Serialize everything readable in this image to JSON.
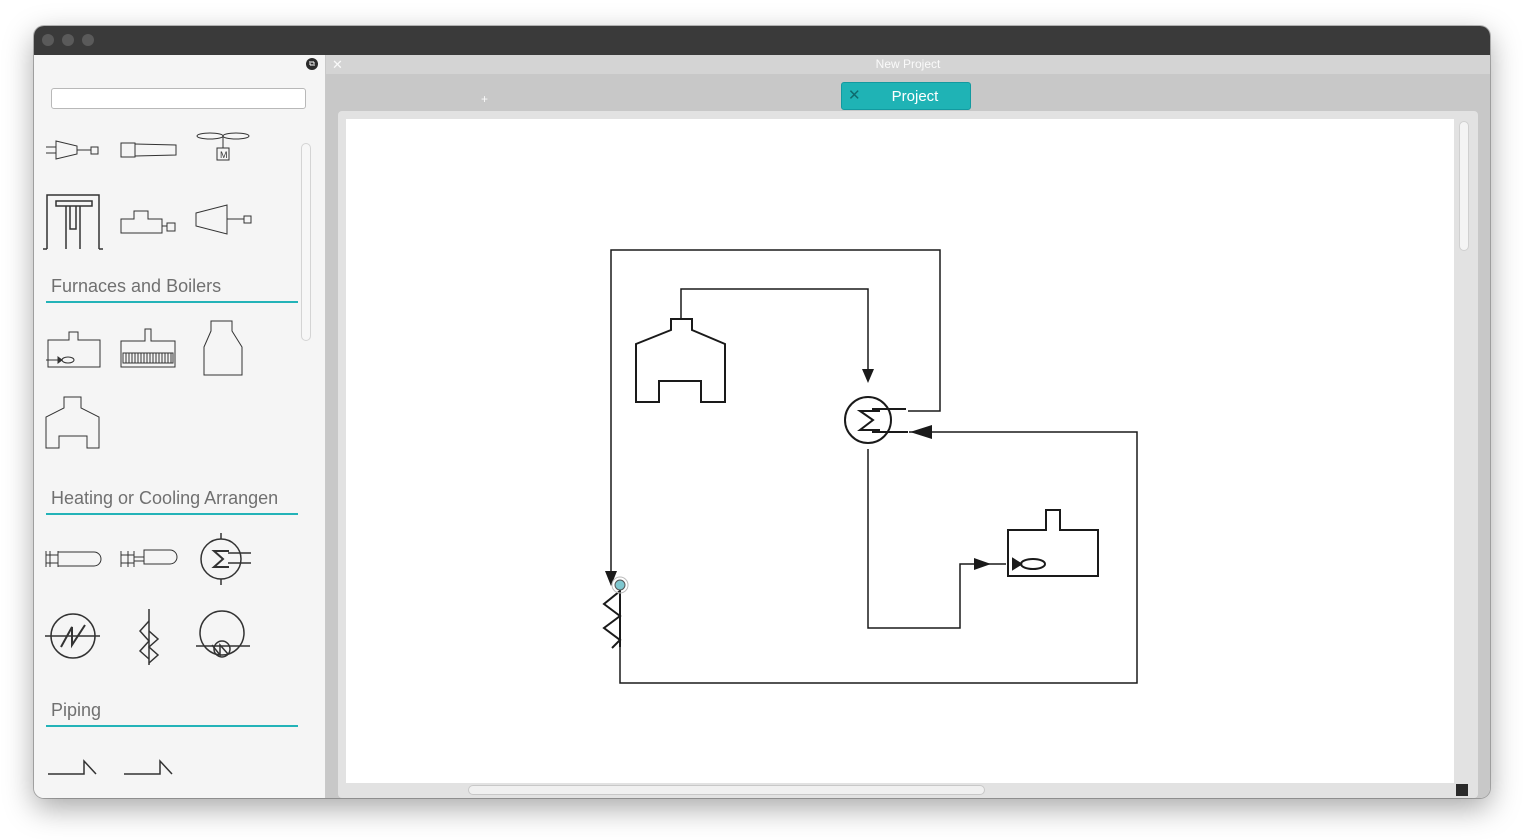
{
  "window": {
    "title": "New Project"
  },
  "sidebar": {
    "search": {
      "value": "",
      "placeholder": ""
    },
    "sections": [
      {
        "title": "Furnaces and Boilers"
      },
      {
        "title": "Heating or Cooling Arrangen"
      },
      {
        "title": "Piping"
      }
    ],
    "icons": {
      "undock": "undock-icon",
      "compressors": [
        "compressor-motor-icon",
        "blower-icon",
        "fan-motor-icon",
        "press-icon",
        "pump-motor-icon",
        "turbine-icon"
      ],
      "furnaces": [
        "furnace-burner-icon",
        "boiler-tubes-icon",
        "bottle-furnace-icon",
        "furnace-icon"
      ],
      "heating": [
        "heater-rod-icon",
        "heater-tube-icon",
        "heat-exchanger-icon",
        "cooler-icon",
        "coil-heater-icon",
        "circular-heater-icon"
      ],
      "piping": [
        "pipe-reducer-icon",
        "pipe-reducer-2-icon"
      ]
    }
  },
  "tabs": {
    "add_label": "+",
    "close_label": "✕",
    "items": [
      {
        "label": "Project",
        "close": "✕"
      }
    ]
  },
  "diagram": {
    "nodes": [
      "furnace",
      "heat-exchanger",
      "burner-furnace",
      "coil-heater"
    ]
  },
  "colors": {
    "accent": "#1fb3b5",
    "titlebar": "#3a3a3a",
    "section_line": "#23b3b8"
  }
}
